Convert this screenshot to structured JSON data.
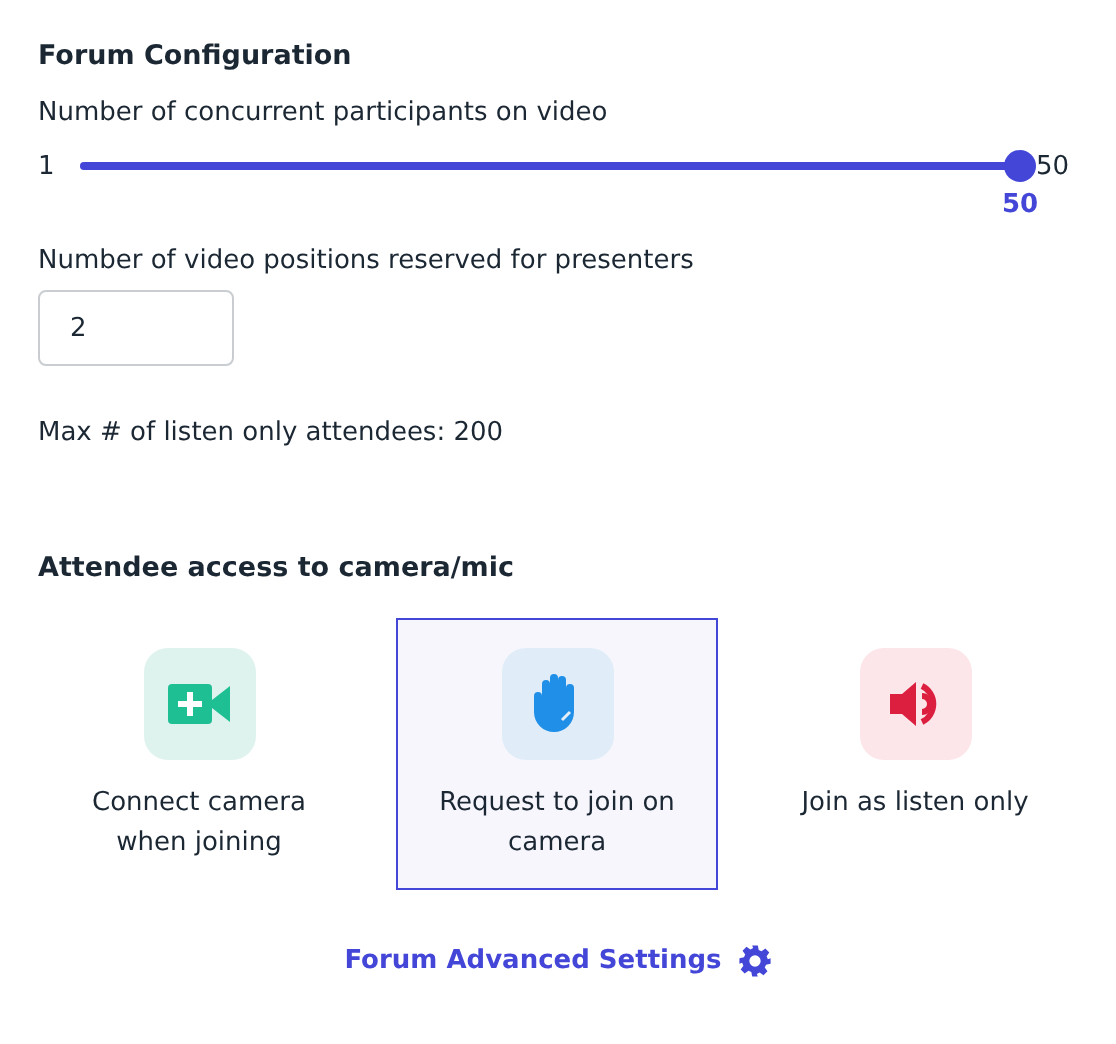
{
  "title": "Forum Configuration",
  "participants": {
    "label": "Number of concurrent participants on video",
    "min_label": "1",
    "max_label": "50",
    "level": 1.0,
    "value": "50"
  },
  "presenters": {
    "label": "Number of video positions reserved for presenters",
    "value": "2"
  },
  "max_listen": "Max # of listen only attendees: 200",
  "access": {
    "title": "Attendee access to camera/mic",
    "options": [
      {
        "kind": "camera",
        "label": "Connect camera when joining",
        "selected": false
      },
      {
        "kind": "hand",
        "label": "Request to join on camera",
        "selected": true
      },
      {
        "kind": "speaker",
        "label": "Join as listen only",
        "selected": false
      }
    ]
  },
  "advanced_link": "Forum Advanced Settings"
}
